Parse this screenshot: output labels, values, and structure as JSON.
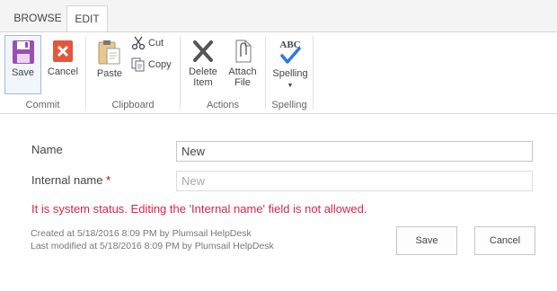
{
  "tabs": {
    "browse": "BROWSE",
    "edit": "EDIT"
  },
  "ribbon": {
    "commit": {
      "label": "Commit",
      "save": "Save",
      "cancel": "Cancel"
    },
    "clipboard": {
      "label": "Clipboard",
      "paste": "Paste",
      "cut": "Cut",
      "copy": "Copy"
    },
    "actions": {
      "label": "Actions",
      "delete_line1": "Delete",
      "delete_line2": "Item",
      "attach_line1": "Attach",
      "attach_line2": "File"
    },
    "spelling": {
      "label": "Spelling",
      "button": "Spelling",
      "abc": "ABC"
    }
  },
  "form": {
    "name_label": "Name",
    "name_value": "New",
    "internal_label": "Internal name",
    "required_mark": "*",
    "internal_value": "New",
    "error": "It is system status. Editing the 'Internal name' field is not allowed.",
    "created": "Created at 5/18/2016 8:09 PM by Plumsail HelpDesk",
    "modified": "Last modified at 5/18/2016 8:09 PM by Plumsail HelpDesk",
    "save": "Save",
    "cancel": "Cancel"
  },
  "colors": {
    "accent": "#9b4fb5",
    "cancel_red": "#e2573d",
    "error": "#e0234a",
    "check_blue": "#2b7cd3"
  }
}
